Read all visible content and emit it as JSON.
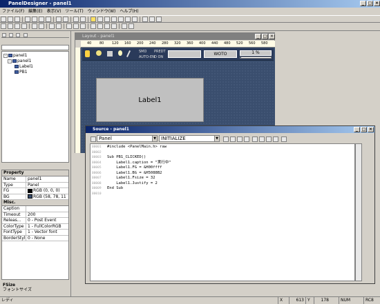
{
  "app": {
    "title": "PanelDesigner - panel1"
  },
  "menu": [
    "ファイル(F)",
    "編集(E)",
    "表示(V)",
    "ツール(T)",
    "ウィンドウ(W)",
    "ヘルプ(H)"
  ],
  "tree": {
    "root": "panel1",
    "child": "panel1",
    "label": "Label1",
    "pb": "PB1"
  },
  "props": {
    "header": "Property",
    "rows": [
      {
        "name": "Name",
        "value": "panel1"
      },
      {
        "name": "Type",
        "value": "Panel"
      },
      {
        "name": "FG",
        "value": "RGB (0, 0, 0)",
        "color": "#000000"
      },
      {
        "name": "BG",
        "value": "RGB (58, 78, 11",
        "color": "#3a4e0b"
      }
    ],
    "misc_header": "Misc.",
    "misc_rows": [
      {
        "name": "Caption",
        "value": ""
      },
      {
        "name": "Timeout",
        "value": "200"
      },
      {
        "name": "Releas...",
        "value": "0 - Post Event"
      },
      {
        "name": "ColorType",
        "value": "1 - FullColorRGB"
      },
      {
        "name": "FontType",
        "value": "1 - Vector font"
      },
      {
        "name": "BorderStyle",
        "value": "0 - None"
      }
    ]
  },
  "help": {
    "title": "FSize",
    "desc": "フォントサイズ"
  },
  "layout": {
    "title": "Layout - panel1",
    "ruler": [
      "40",
      "80",
      "120",
      "160",
      "200",
      "240",
      "280",
      "320",
      "360",
      "400",
      "440",
      "480",
      "520",
      "560",
      "580"
    ],
    "label1": "Label1",
    "ctl": {
      "ind1": "SMD",
      "ind2": "PREDT",
      "ind3": "AUTO-EN",
      "ind4": "D ON",
      "wheel": "WOTO",
      "pct": "1 %"
    }
  },
  "source": {
    "title": "Source - panel1",
    "combo_left": "Panel",
    "combo_right": "INITIALIZE",
    "lines": [
      {
        "no": "00001",
        "code": "#include <PanelMain.h> raw"
      },
      {
        "no": "00002",
        "code": ""
      },
      {
        "no": "00003",
        "code": "Sub PB1_CLICKED()"
      },
      {
        "no": "00004",
        "code": "    Label1.caption = \"実行中\""
      },
      {
        "no": "00005",
        "code": "    Label1.FG = &H00ffff"
      },
      {
        "no": "00006",
        "code": "    Label1.BG = &H5088B2"
      },
      {
        "no": "00007",
        "code": "    Label1.Fsize = 32"
      },
      {
        "no": "00008",
        "code": "    Label1.Justify = 2"
      },
      {
        "no": "00009",
        "code": "End Sub"
      },
      {
        "no": "00010",
        "code": ""
      }
    ]
  },
  "status": {
    "ready": "レディ",
    "x": "X",
    "xval": "613",
    "y": "Y",
    "yval": "178",
    "num": "NUM",
    "rc": "RC8"
  }
}
